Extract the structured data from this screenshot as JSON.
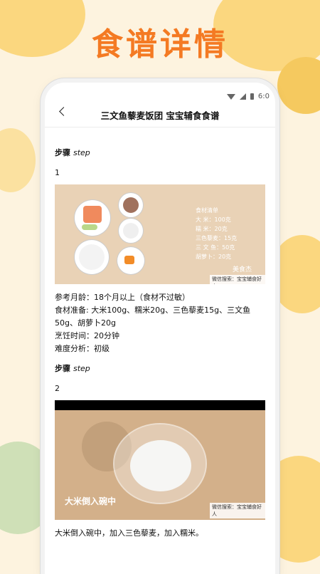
{
  "banner": {
    "title": "食谱详情"
  },
  "status": {
    "time": "6:0"
  },
  "nav": {
    "title": "三文鱼藜麦饭团 宝宝辅食食谱"
  },
  "steps": [
    {
      "heading": "步骤",
      "heading_en": "step",
      "number": "1",
      "image_notes": [
        "食材清单",
        "大 米：100克",
        "糯 米：20克",
        "三色藜麦：15克",
        "三 文 鱼：50克",
        "胡萝卜：20克"
      ],
      "image_brand": "美食杰",
      "image_watermark": "微信搜索：宝宝辅食好人",
      "lines": [
        "参考月龄：18个月以上（食材不过敏）",
        "食材准备: 大米100g、糯米20g、三色藜麦15g、三文鱼50g、胡萝卜20g",
        "烹饪时间：20分钟",
        "难度分析：初级"
      ]
    },
    {
      "heading": "步骤",
      "heading_en": "step",
      "number": "2",
      "image_caption": "大米倒入碗中",
      "image_watermark": "微信搜索：宝宝辅食好人",
      "lines": [
        "大米倒入碗中，加入三色藜麦，加入糯米。"
      ]
    }
  ],
  "colors": {
    "accent": "#f47a23",
    "background": "#fdf3df"
  }
}
